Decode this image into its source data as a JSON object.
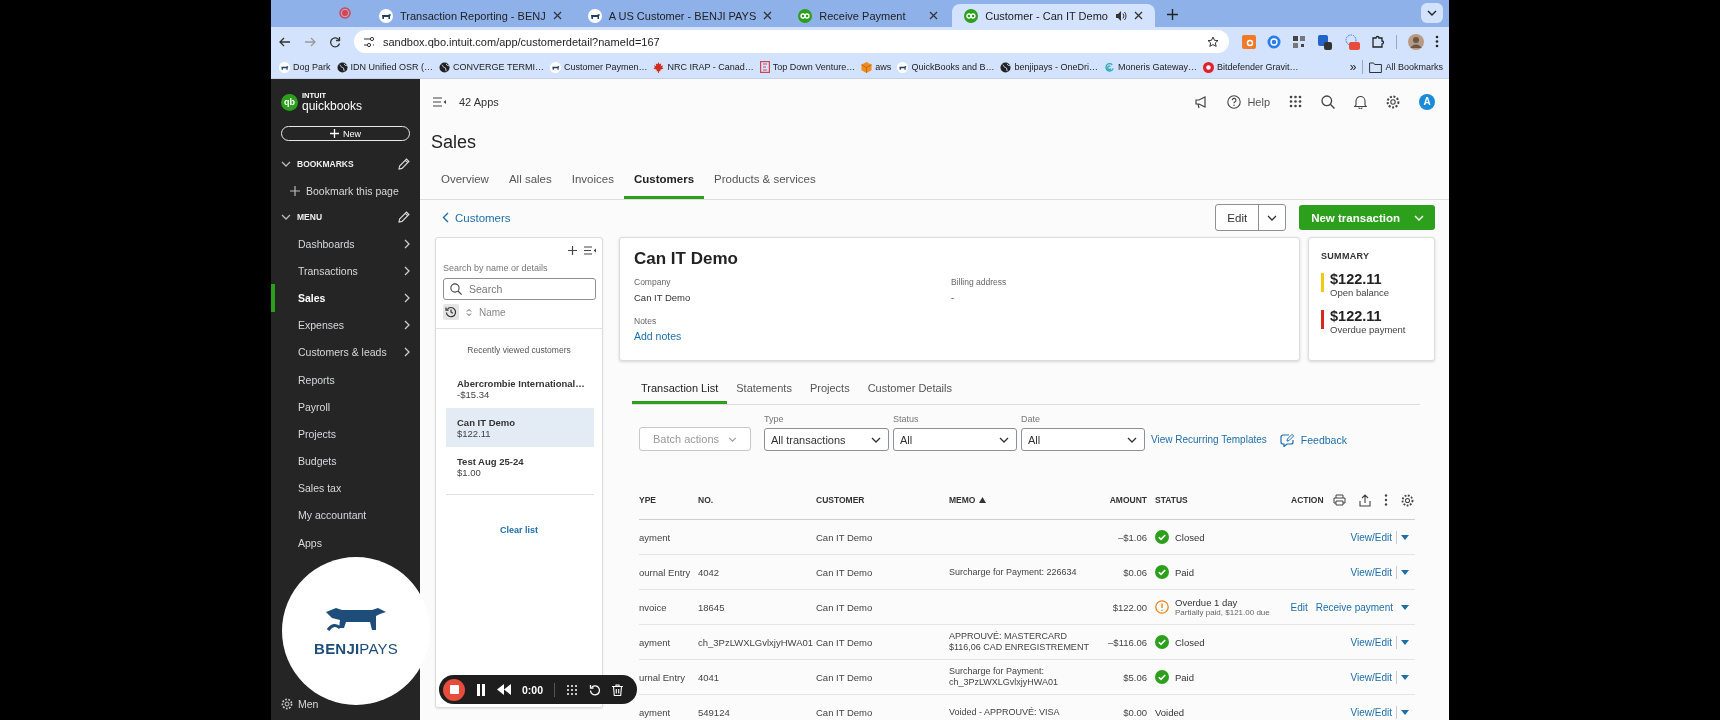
{
  "browser": {
    "tabs": [
      {
        "title": "Transaction Reporting - BENJ",
        "kind": "benji",
        "selected": false,
        "audio": false
      },
      {
        "title": "A US Customer - BENJI PAYS",
        "kind": "benji",
        "selected": false,
        "audio": false
      },
      {
        "title": "Receive Payment",
        "kind": "qb",
        "selected": false,
        "audio": false
      },
      {
        "title": "Customer - Can IT Demo",
        "kind": "qb",
        "selected": true,
        "audio": true
      }
    ],
    "url": "sandbox.qbo.intuit.com/app/customerdetail?nameId=167",
    "bookmarks": [
      {
        "label": "Dog Park",
        "kind": "benji"
      },
      {
        "label": "IDN Unified OSR (…",
        "kind": "globe"
      },
      {
        "label": "CONVERGE TERMI…",
        "kind": "globe"
      },
      {
        "label": "Customer Paymen…",
        "kind": "benji"
      },
      {
        "label": "NRC IRAP - Canad…",
        "kind": "maple"
      },
      {
        "label": "Top Down Venture…",
        "kind": "square"
      },
      {
        "label": "aws",
        "kind": "cube"
      },
      {
        "label": "QuickBooks and B…",
        "kind": "benji"
      },
      {
        "label": "benjipays - OneDri…",
        "kind": "globe"
      },
      {
        "label": "Moneris Gateway…",
        "kind": "swirl"
      },
      {
        "label": "Bitdefender Gravit…",
        "kind": "redcircle"
      }
    ],
    "more_bookmarks": "»",
    "all_bookmarks": "All Bookmarks"
  },
  "sidebar": {
    "logo_top": "INTUIT",
    "logo": "quickbooks",
    "logo_mark": "qb",
    "new_button": "New",
    "sections": [
      {
        "title": "BOOKMARKS",
        "expanded": true,
        "items": [
          {
            "label": "Bookmark this page",
            "kind": "add",
            "selected": false,
            "has_submenu": false
          }
        ]
      },
      {
        "title": "MENU",
        "expanded": true,
        "items": [
          {
            "label": "Dashboards",
            "kind": "link",
            "selected": false,
            "has_submenu": true
          },
          {
            "label": "Transactions",
            "kind": "link",
            "selected": false,
            "has_submenu": true
          },
          {
            "label": "Sales",
            "kind": "link",
            "selected": true,
            "has_submenu": true
          },
          {
            "label": "Expenses",
            "kind": "link",
            "selected": false,
            "has_submenu": true
          },
          {
            "label": "Customers & leads",
            "kind": "link",
            "selected": false,
            "has_submenu": true
          },
          {
            "label": "Reports",
            "kind": "link",
            "selected": false,
            "has_submenu": false
          },
          {
            "label": "Payroll",
            "kind": "link",
            "selected": false,
            "has_submenu": false
          },
          {
            "label": "Projects",
            "kind": "link",
            "selected": false,
            "has_submenu": false
          },
          {
            "label": "Budgets",
            "kind": "link",
            "selected": false,
            "has_submenu": false
          },
          {
            "label": "Sales tax",
            "kind": "link",
            "selected": false,
            "has_submenu": false
          },
          {
            "label": "My accountant",
            "kind": "link",
            "selected": false,
            "has_submenu": false
          },
          {
            "label": "Apps",
            "kind": "link",
            "selected": false,
            "has_submenu": false
          }
        ]
      }
    ],
    "footer": "Men"
  },
  "topbar": {
    "apps_label": "42 Apps",
    "help": "Help",
    "avatar": "A"
  },
  "page": {
    "title": "Sales",
    "tabs": [
      {
        "label": "Overview",
        "selected": false
      },
      {
        "label": "All sales",
        "selected": false
      },
      {
        "label": "Invoices",
        "selected": false
      },
      {
        "label": "Customers",
        "selected": true
      },
      {
        "label": "Products & services",
        "selected": false
      }
    ]
  },
  "back_link": "Customers",
  "actions": {
    "edit": "Edit",
    "new_transaction": "New transaction"
  },
  "customer_list": {
    "search_label": "Search by name or details",
    "search_placeholder": "Search",
    "sort_label": "Name",
    "recent_title": "Recently viewed customers",
    "items": [
      {
        "name": "Abercrombie International…",
        "balance": "-$15.34",
        "selected": false
      },
      {
        "name": "Can IT Demo",
        "balance": "$122.11",
        "selected": true
      },
      {
        "name": "Test Aug 25-24",
        "balance": "$1.00",
        "selected": false
      }
    ],
    "clear": "Clear list"
  },
  "customer": {
    "name": "Can IT Demo",
    "fields": [
      {
        "label": "Company",
        "value": "Can IT Demo"
      },
      {
        "label": "Billing address",
        "value": "-"
      }
    ],
    "notes_label": "Notes",
    "notes_link": "Add notes"
  },
  "summary": {
    "title": "SUMMARY",
    "items": [
      {
        "amount": "$122.11",
        "label": "Open balance",
        "color": "#f2c811"
      },
      {
        "amount": "$122.11",
        "label": "Overdue payment",
        "color": "#d52b1e"
      }
    ]
  },
  "detail_tabs": [
    {
      "label": "Transaction List",
      "selected": true
    },
    {
      "label": "Statements",
      "selected": false
    },
    {
      "label": "Projects",
      "selected": false
    },
    {
      "label": "Customer Details",
      "selected": false
    }
  ],
  "filters": {
    "batch": "Batch actions",
    "selects": [
      {
        "label": "Type",
        "value": "All transactions"
      },
      {
        "label": "Status",
        "value": "All"
      },
      {
        "label": "Date",
        "value": "All"
      }
    ],
    "recurring_link": "View Recurring Templates",
    "feedback": "Feedback"
  },
  "table": {
    "columns": [
      {
        "label": "YPE"
      },
      {
        "label": "NO."
      },
      {
        "label": "CUSTOMER"
      },
      {
        "label": "MEMO",
        "sort_ascending": true
      },
      {
        "label": "AMOUNT"
      },
      {
        "label": "STATUS"
      },
      {
        "label": "ACTION"
      }
    ],
    "rows": [
      {
        "type": "ayment",
        "customer": "Can IT Demo",
        "amount": "–$1.06",
        "status": {
          "kind": "closed",
          "text": "Closed"
        },
        "actions": [
          "View/Edit"
        ]
      },
      {
        "type": "ournal Entry",
        "no": "4042",
        "customer": "Can IT Demo",
        "memo": "Surcharge for Payment: 226634",
        "amount": "$0.06",
        "status": {
          "kind": "paid",
          "text": "Paid"
        },
        "actions": [
          "View/Edit"
        ]
      },
      {
        "type": "nvoice",
        "no": "18645",
        "customer": "Can IT Demo",
        "amount": "$122.00",
        "status": {
          "kind": "overdue",
          "text": "Overdue 1 day",
          "detail": "Partially paid, $121.00 due"
        },
        "actions": [
          "Edit",
          "Receive payment"
        ]
      },
      {
        "type": "ayment",
        "no": "ch_3PzLWXLGvlxjyHWA01",
        "customer": "Can IT Demo",
        "memo": "APPROUVÉ: MASTERCARD\n$116,06 CAD ENREGISTREMENT",
        "amount": "–$116.06",
        "status": {
          "kind": "closed",
          "text": "Closed"
        },
        "actions": [
          "View/Edit"
        ]
      },
      {
        "type": "urnal Entry",
        "no": "4041",
        "customer": "Can IT Demo",
        "memo": "Surcharge for Payment:\nch_3PzLWXLGvlxjyHWA01",
        "amount": "$5.06",
        "status": {
          "kind": "paid",
          "text": "Paid"
        },
        "actions": [
          "View/Edit"
        ]
      },
      {
        "type": "ayment",
        "no": "549124",
        "customer": "Can IT Demo",
        "memo": "Voided - APPROUVÉ: VISA",
        "amount": "$0.00",
        "status": {
          "kind": "voided",
          "text": "Voided"
        },
        "actions": [
          "View/Edit"
        ]
      }
    ]
  },
  "recorder": {
    "time": "0:00"
  },
  "overlay_logo": {
    "wordmark": "**BENJI**PAYS"
  }
}
